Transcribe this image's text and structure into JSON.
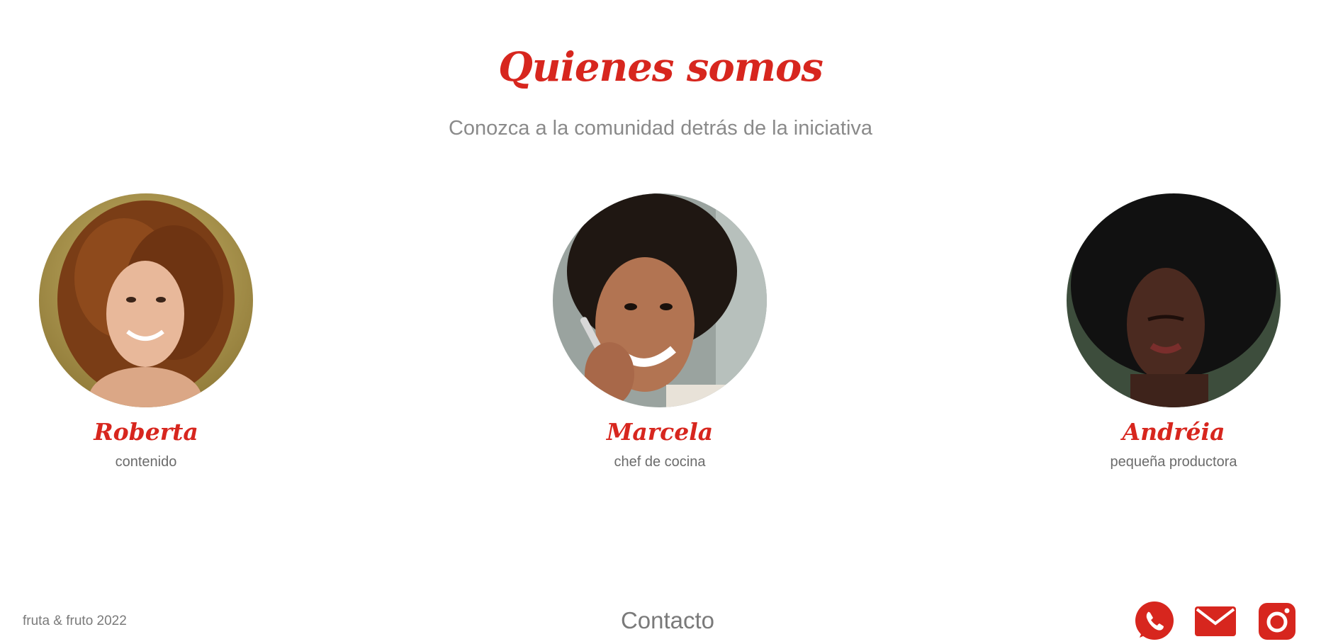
{
  "section": {
    "title": "Quienes somos",
    "subtitle": "Conozca a la comunidad detrás de la iniciativa"
  },
  "members": [
    {
      "name": "Roberta",
      "role": "contenido"
    },
    {
      "name": "Marcela",
      "role": "chef de cocina"
    },
    {
      "name": "Andréia",
      "role": "pequeña productora"
    }
  ],
  "footer": {
    "copyright": "fruta & fruto 2022",
    "contact_label": "Contacto",
    "social": [
      {
        "icon": "whatsapp-icon"
      },
      {
        "icon": "mail-icon"
      },
      {
        "icon": "instagram-icon"
      }
    ]
  },
  "colors": {
    "accent": "#d7261e",
    "text_muted": "#8a8a8a",
    "text": "#6b6b6b"
  }
}
